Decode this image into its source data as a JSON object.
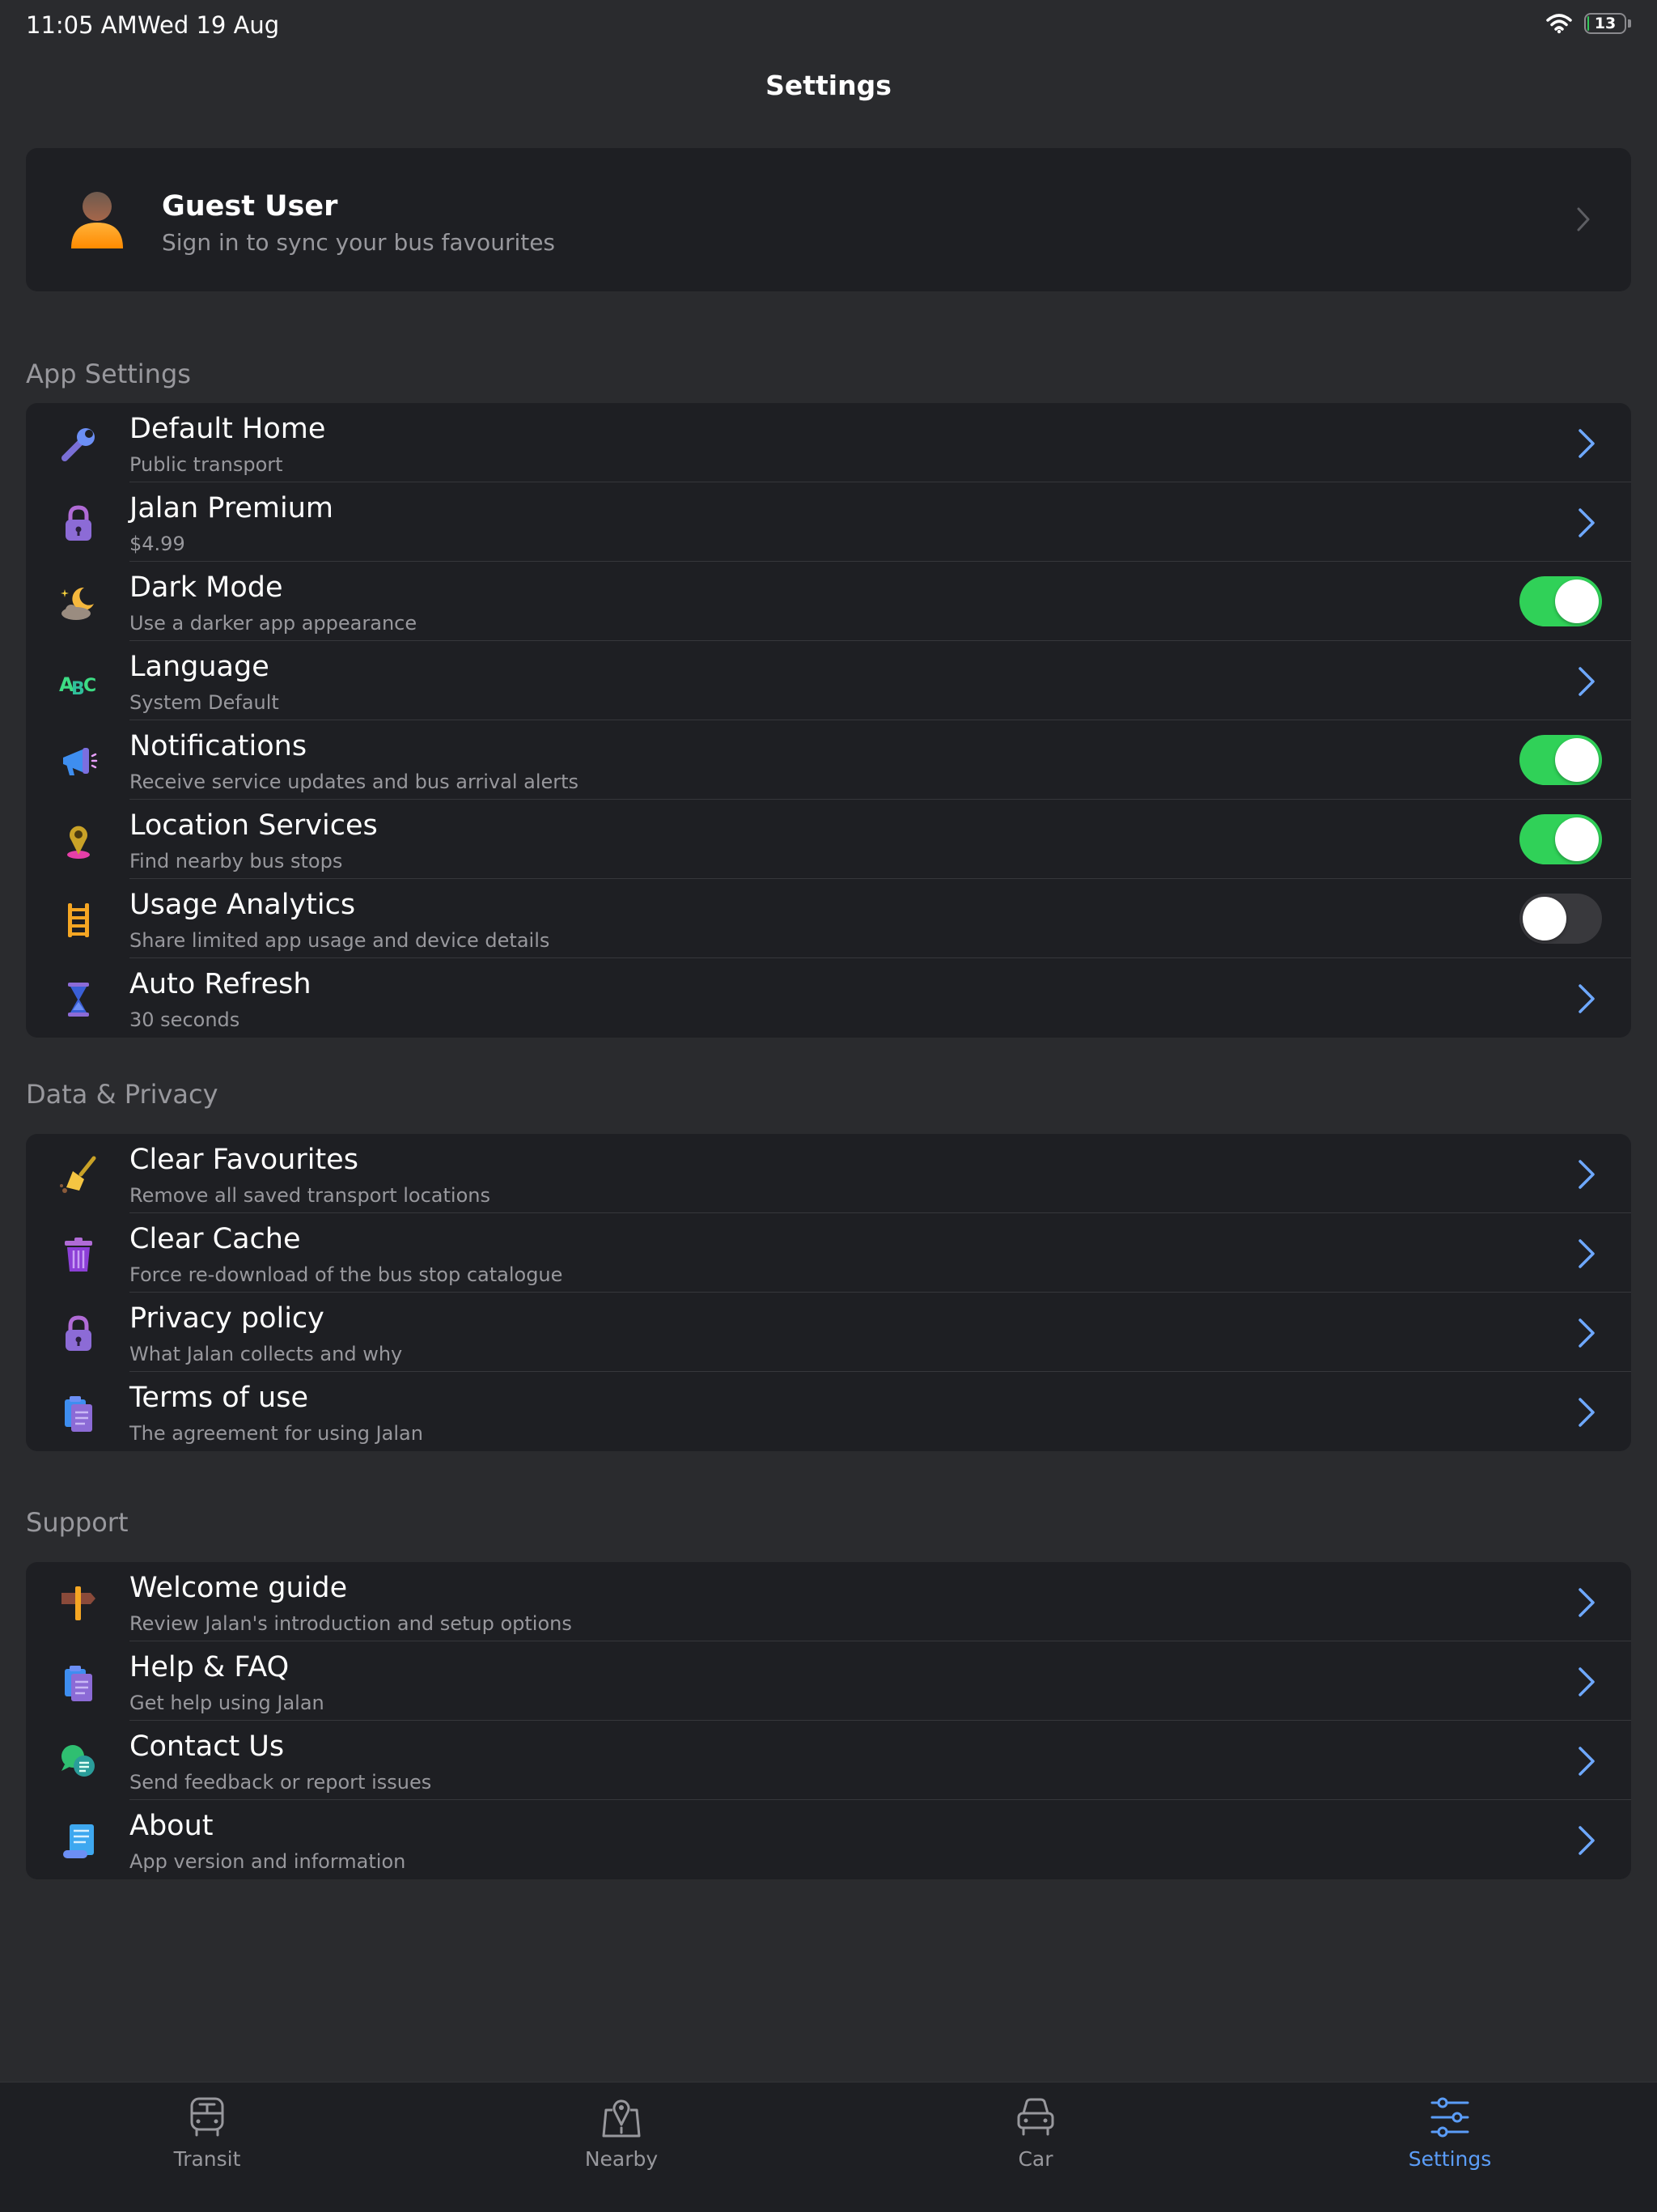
{
  "status_bar": {
    "time": "11:05 AM",
    "date": "Wed 19 Aug",
    "battery": "13",
    "battery_level_percent": 13
  },
  "nav": {
    "title": "Settings"
  },
  "profile": {
    "name": "Guest User",
    "subtitle": "Sign in to sync your bus favourites"
  },
  "sections": {
    "app_settings": {
      "header": "App Settings",
      "items": [
        {
          "title": "Default Home",
          "subtitle": "Public transport",
          "icon": "wrench-icon",
          "control": "chevron"
        },
        {
          "title": "Jalan Premium",
          "subtitle": "$4.99",
          "icon": "lock-icon",
          "control": "chevron"
        },
        {
          "title": "Dark Mode",
          "subtitle": "Use a darker app appearance",
          "icon": "moon-cloud-icon",
          "control": "toggle",
          "on": true
        },
        {
          "title": "Language",
          "subtitle": "System Default",
          "icon": "abc-icon",
          "control": "chevron"
        },
        {
          "title": "Notifications",
          "subtitle": "Receive service updates and bus arrival alerts",
          "icon": "megaphone-icon",
          "control": "toggle",
          "on": true
        },
        {
          "title": "Location Services",
          "subtitle": "Find nearby bus stops",
          "icon": "pin-icon",
          "control": "toggle",
          "on": true
        },
        {
          "title": "Usage Analytics",
          "subtitle": "Share limited app usage and device details",
          "icon": "ladder-icon",
          "control": "toggle",
          "on": false
        },
        {
          "title": "Auto Refresh",
          "subtitle": "30 seconds",
          "icon": "hourglass-icon",
          "control": "chevron"
        }
      ]
    },
    "data_privacy": {
      "header": "Data & Privacy",
      "items": [
        {
          "title": "Clear Favourites",
          "subtitle": "Remove all saved transport locations",
          "icon": "broom-icon",
          "control": "chevron"
        },
        {
          "title": "Clear Cache",
          "subtitle": "Force re-download of the bus stop catalogue",
          "icon": "trash-icon",
          "control": "chevron"
        },
        {
          "title": "Privacy policy",
          "subtitle": "What Jalan collects and why",
          "icon": "lock-icon",
          "control": "chevron"
        },
        {
          "title": "Terms of use",
          "subtitle": "The agreement for using Jalan",
          "icon": "clipboard-icon",
          "control": "chevron"
        }
      ]
    },
    "support": {
      "header": "Support",
      "items": [
        {
          "title": "Welcome guide",
          "subtitle": "Review Jalan's introduction and setup options",
          "icon": "signpost-icon",
          "control": "chevron"
        },
        {
          "title": "Help & FAQ",
          "subtitle": "Get help using Jalan",
          "icon": "clipboard-icon",
          "control": "chevron"
        },
        {
          "title": "Contact Us",
          "subtitle": "Send feedback or report issues",
          "icon": "speech-bubbles-icon",
          "control": "chevron"
        },
        {
          "title": "About",
          "subtitle": "App version and information",
          "icon": "scroll-icon",
          "control": "chevron"
        }
      ]
    }
  },
  "tab_bar": {
    "items": [
      {
        "label": "Transit",
        "icon": "bus-icon",
        "active": false
      },
      {
        "label": "Nearby",
        "icon": "map-pin-icon",
        "active": false
      },
      {
        "label": "Car",
        "icon": "car-icon",
        "active": false
      },
      {
        "label": "Settings",
        "icon": "sliders-icon",
        "active": true
      }
    ]
  },
  "colors": {
    "accent": "#5b9df8",
    "toggle_on": "#30d158",
    "background": "#2a2b2e",
    "card": "#1e1f23"
  }
}
